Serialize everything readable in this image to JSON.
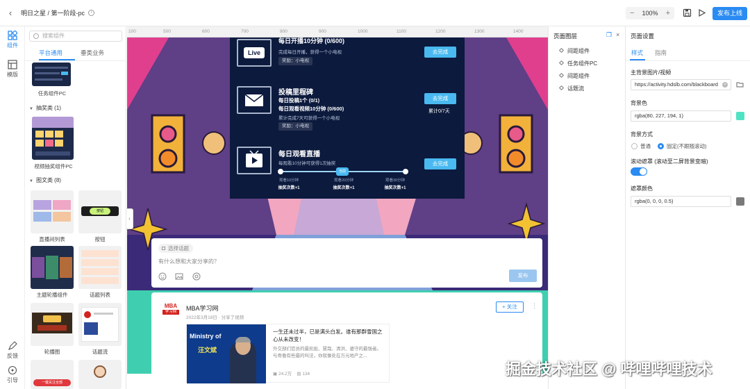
{
  "header": {
    "breadcrumb": "明日之星 / 第一阶段-pc",
    "zoom_out": "−",
    "zoom_in": "+",
    "zoom_level": "100%",
    "publish_label": "发布上线"
  },
  "rail": {
    "items": [
      {
        "label": "组件",
        "icon": "puzzle-icon"
      },
      {
        "label": "模版",
        "icon": "template-icon"
      },
      {
        "label": "反馈",
        "icon": "feedback-icon"
      },
      {
        "label": "引导",
        "icon": "guide-icon"
      }
    ]
  },
  "components": {
    "search_placeholder": "搜索组件",
    "tabs": [
      "平台通用",
      "垂类业务"
    ],
    "groups": [
      {
        "title": "抽奖类 (1)"
      },
      {
        "title": "图文类 (8)"
      }
    ],
    "items": [
      {
        "label": "任务组件PC"
      },
      {
        "label": "视频抽奖组件PC"
      },
      {
        "label": "直播间列表"
      },
      {
        "label": "按钮"
      },
      {
        "label": "主题轮播组件"
      },
      {
        "label": "话题列表"
      },
      {
        "label": "轮播图"
      },
      {
        "label": "话题流"
      }
    ],
    "btn_thumb_text": "按钮",
    "red_banner_text": "一键关注全部"
  },
  "ruler": [
    "100",
    "500",
    "600",
    "700",
    "800",
    "900",
    "1000",
    "1100",
    "1200",
    "1300",
    "1400"
  ],
  "canvas": {
    "tasks": [
      {
        "title": "每日开播10分钟 (0/600)",
        "sub": "完成每日开播，获得一个小电视",
        "reward": "奖励：小电视",
        "button": "去完成"
      },
      {
        "title": "投稿里程碑",
        "line1": "每日投稿1个 (0/1)",
        "line2": "每日观看视频10分钟 (0/600)",
        "sub": "累计完成7天可获得一个小电视",
        "reward": "奖励：小电视",
        "button": "去完成",
        "cumulative": "累计0/7天"
      },
      {
        "title": "每日观看直播",
        "sub": "每观看10分钟可获得1次抽奖",
        "button": "去完成"
      }
    ],
    "progress_pill": "当前",
    "milestones": [
      {
        "time": "观看10分钟",
        "reward": "抽奖次数+1"
      },
      {
        "time": "观看20分钟",
        "reward": "抽奖次数+1"
      },
      {
        "time": "观看30分钟",
        "reward": "抽奖次数+1"
      }
    ],
    "composer": {
      "topic": "选择话题",
      "placeholder": "有什么想和大家分享的？",
      "send": "发布"
    },
    "feed": {
      "logo_top": "MBA",
      "logo_bottom": "学习网",
      "account": "MBA学习网",
      "meta": "2022年3月18日 · 分享了视频",
      "follow": "+ 关注",
      "card_title": "一生还未过半，已是满头白发。谁有那群雪国之心从未改变！",
      "card_desc": "外交部们官员的最凯批、慧哉、清洪、婆守的最强者。与骨傲有些最的叫法，你就像处在万元地产之...",
      "views": "24.2万",
      "comments": "134",
      "img_text": "Ministry of",
      "img_name": "汪文斌"
    }
  },
  "layers": {
    "title": "页面图层",
    "items": [
      "间距组件",
      "任务组件PC",
      "间距组件",
      "话题流"
    ]
  },
  "settings": {
    "title": "页面设置",
    "tabs": [
      "样式",
      "指南"
    ],
    "bg_label": "主背景图片/视频",
    "bg_url": "https://activity.hdslb.com/blackboard",
    "bg_color_label": "背景色",
    "bg_color": "rgba(80, 227, 194, 1)",
    "bg_mode_label": "背景方式",
    "mode_options": [
      "普通",
      "固定(不跟随滚动)"
    ],
    "scroll_mask_label": "滚动遮罩 (滚动至二屏背景变暗)",
    "mask_color_label": "遮罩颜色",
    "mask_color": "rgba(0, 0, 0, 0.5)"
  },
  "colors": {
    "accent": "#2a8bf2",
    "bg_swatch": "#50e3c2",
    "mask_swatch": "#7a7a7a"
  },
  "watermark": "掘金技术社区 @ 哔哩哔哩技术"
}
